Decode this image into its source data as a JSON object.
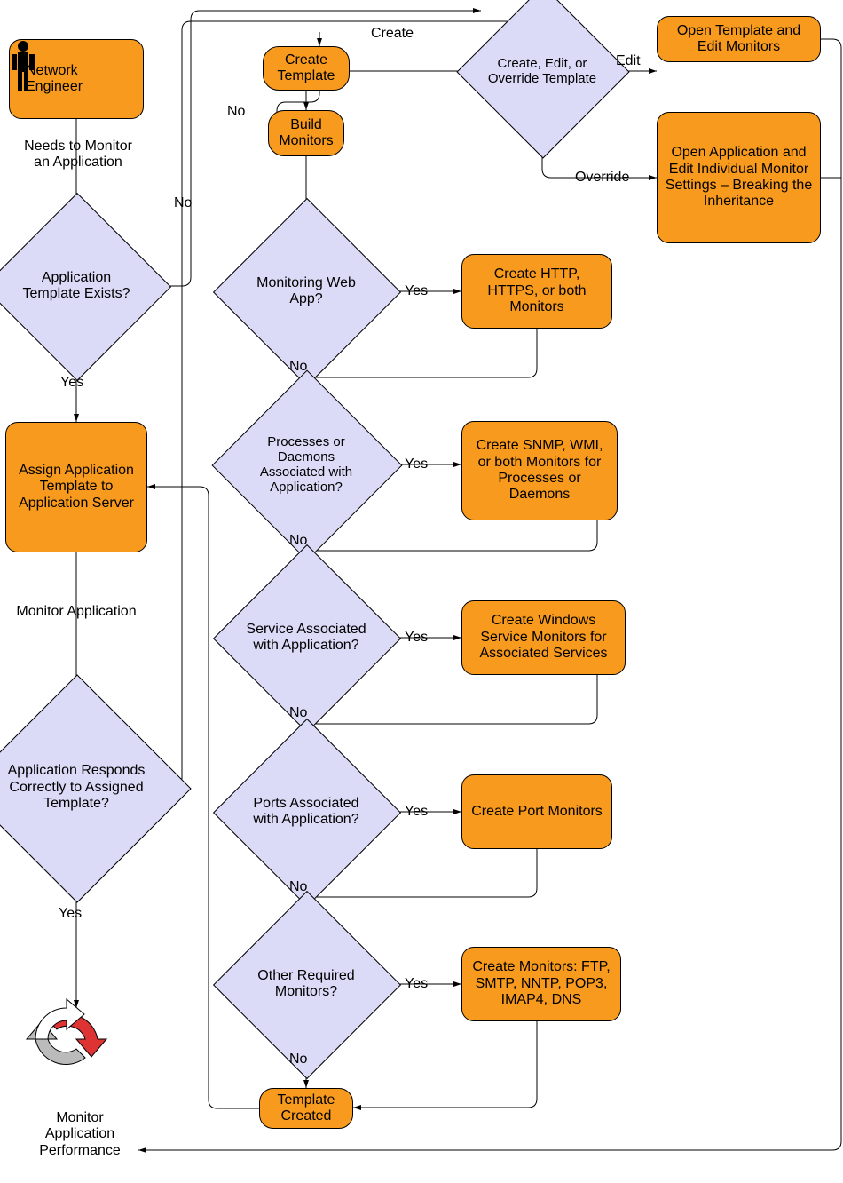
{
  "nodes": {
    "actor": "Network Engineer",
    "assign": "Assign Application Template to Application Server",
    "create_template": "Create Template",
    "build_monitors": "Build Monitors",
    "create_http": "Create HTTP, HTTPS, or both Monitors",
    "create_snmp": "Create SNMP, WMI, or both Monitors for Processes or Daemons",
    "create_winservice": "Create Windows Service Monitors for Associated Services",
    "create_port": "Create Port Monitors",
    "create_other": "Create Monitors: FTP, SMTP, NNTP, POP3, IMAP4, DNS",
    "template_created": "Template Created",
    "open_template": "Open Template and Edit Monitors",
    "open_application": "Open Application and Edit Individual Monitor Settings – Breaking the Inheritance"
  },
  "decisions": {
    "template_exists": "Application Template Exists?",
    "responds_correctly": "Application Responds Correctly to Assigned Template?",
    "monitoring_web": "Monitoring Web App?",
    "processes": "Processes or Daemons Associated with Application?",
    "service": "Service Associated with Application?",
    "ports": "Ports Associated with Application?",
    "other_monitors": "Other Required Monitors?",
    "create_edit_override": "Create, Edit, or Override Template"
  },
  "edges": {
    "needs_monitor": "Needs to Monitor an Application",
    "yes": "Yes",
    "no": "No",
    "monitor_application": "Monitor Application",
    "create": "Create",
    "edit": "Edit",
    "override": "Override"
  },
  "captions": {
    "monitor_perf": "Monitor Application Performance"
  }
}
